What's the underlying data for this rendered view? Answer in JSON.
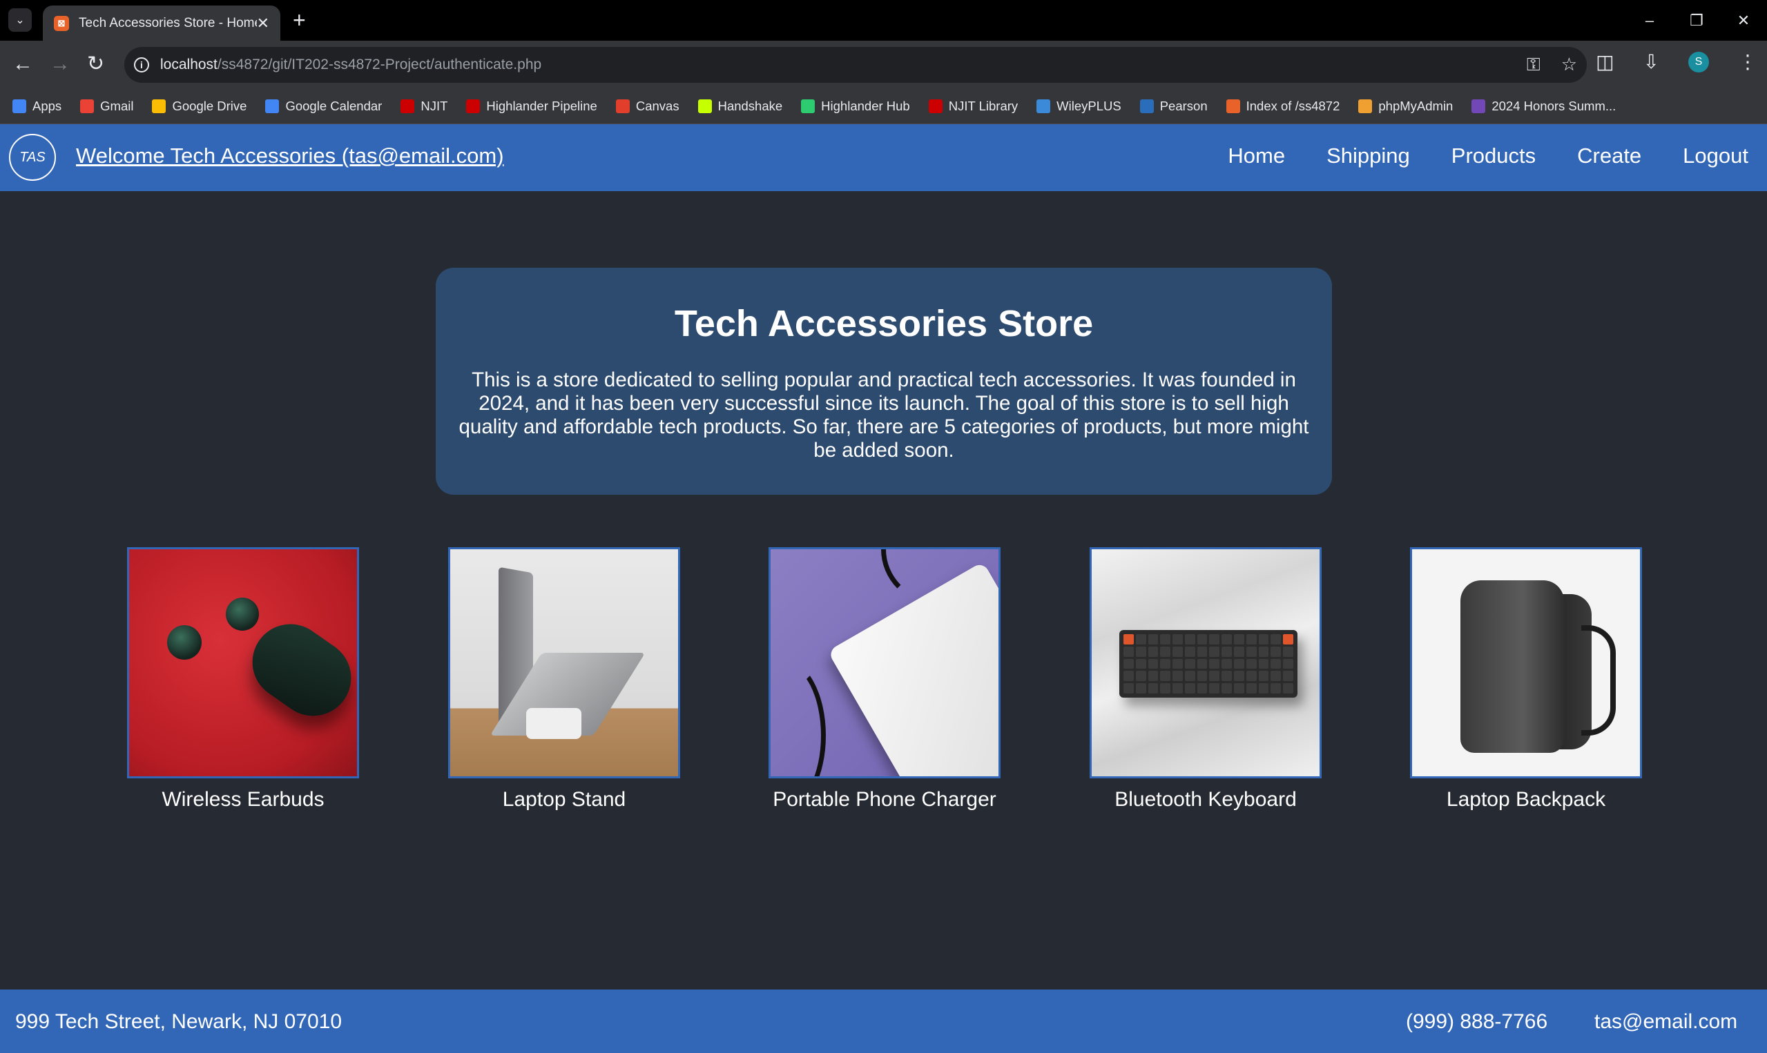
{
  "browser": {
    "tab_title": "Tech Accessories Store - Home",
    "url_host": "localhost",
    "url_path": "/ss4872/git/IT202-ss4872-Project/authenticate.php",
    "profile_initial": "S",
    "bookmarks": [
      {
        "label": "Apps",
        "icon": "apps-grid-icon",
        "color": "#4285f4"
      },
      {
        "label": "Gmail",
        "icon": "gmail-icon",
        "color": "#ea4335"
      },
      {
        "label": "Google Drive",
        "icon": "google-drive-icon",
        "color": "#fbbc04"
      },
      {
        "label": "Google Calendar",
        "icon": "google-calendar-icon",
        "color": "#4285f4"
      },
      {
        "label": "NJIT",
        "icon": "njit-icon",
        "color": "#cc0000"
      },
      {
        "label": "Highlander Pipeline",
        "icon": "njit-icon",
        "color": "#cc0000"
      },
      {
        "label": "Canvas",
        "icon": "canvas-icon",
        "color": "#e13f2b"
      },
      {
        "label": "Handshake",
        "icon": "handshake-icon",
        "color": "#c6ff00"
      },
      {
        "label": "Highlander Hub",
        "icon": "highlander-hub-icon",
        "color": "#2ecc71"
      },
      {
        "label": "NJIT Library",
        "icon": "njit-icon",
        "color": "#cc0000"
      },
      {
        "label": "WileyPLUS",
        "icon": "wileyplus-icon",
        "color": "#3b8ad9"
      },
      {
        "label": "Pearson",
        "icon": "pearson-icon",
        "color": "#2a6ebb"
      },
      {
        "label": "Index of /ss4872",
        "icon": "xampp-icon",
        "color": "#e8622a"
      },
      {
        "label": "phpMyAdmin",
        "icon": "phpmyadmin-icon",
        "color": "#f0a030"
      },
      {
        "label": "2024 Honors Summ...",
        "icon": "form-icon",
        "color": "#7248b9"
      }
    ]
  },
  "header": {
    "logo_text": "TAS",
    "welcome": "Welcome Tech Accessories (tas@email.com)",
    "nav": [
      "Home",
      "Shipping",
      "Products",
      "Create",
      "Logout"
    ]
  },
  "hero": {
    "title": "Tech Accessories Store",
    "description": "This is a store dedicated to selling popular and practical tech accessories. It was founded in 2024, and it has been very successful since its launch. The goal of this store is to sell high quality and affordable tech products. So far, there are 5 categories of products, but more might be added soon."
  },
  "products": [
    {
      "name": "Wireless Earbuds"
    },
    {
      "name": "Laptop Stand"
    },
    {
      "name": "Portable Phone Charger"
    },
    {
      "name": "Bluetooth Keyboard"
    },
    {
      "name": "Laptop Backpack"
    }
  ],
  "footer": {
    "address": "999 Tech Street, Newark, NJ 07010",
    "phone": "(999) 888-7766",
    "email": "tas@email.com"
  },
  "colors": {
    "brand_blue": "#3267b8",
    "page_bg": "#262a33",
    "hero_bg": "#2d4a6f"
  }
}
